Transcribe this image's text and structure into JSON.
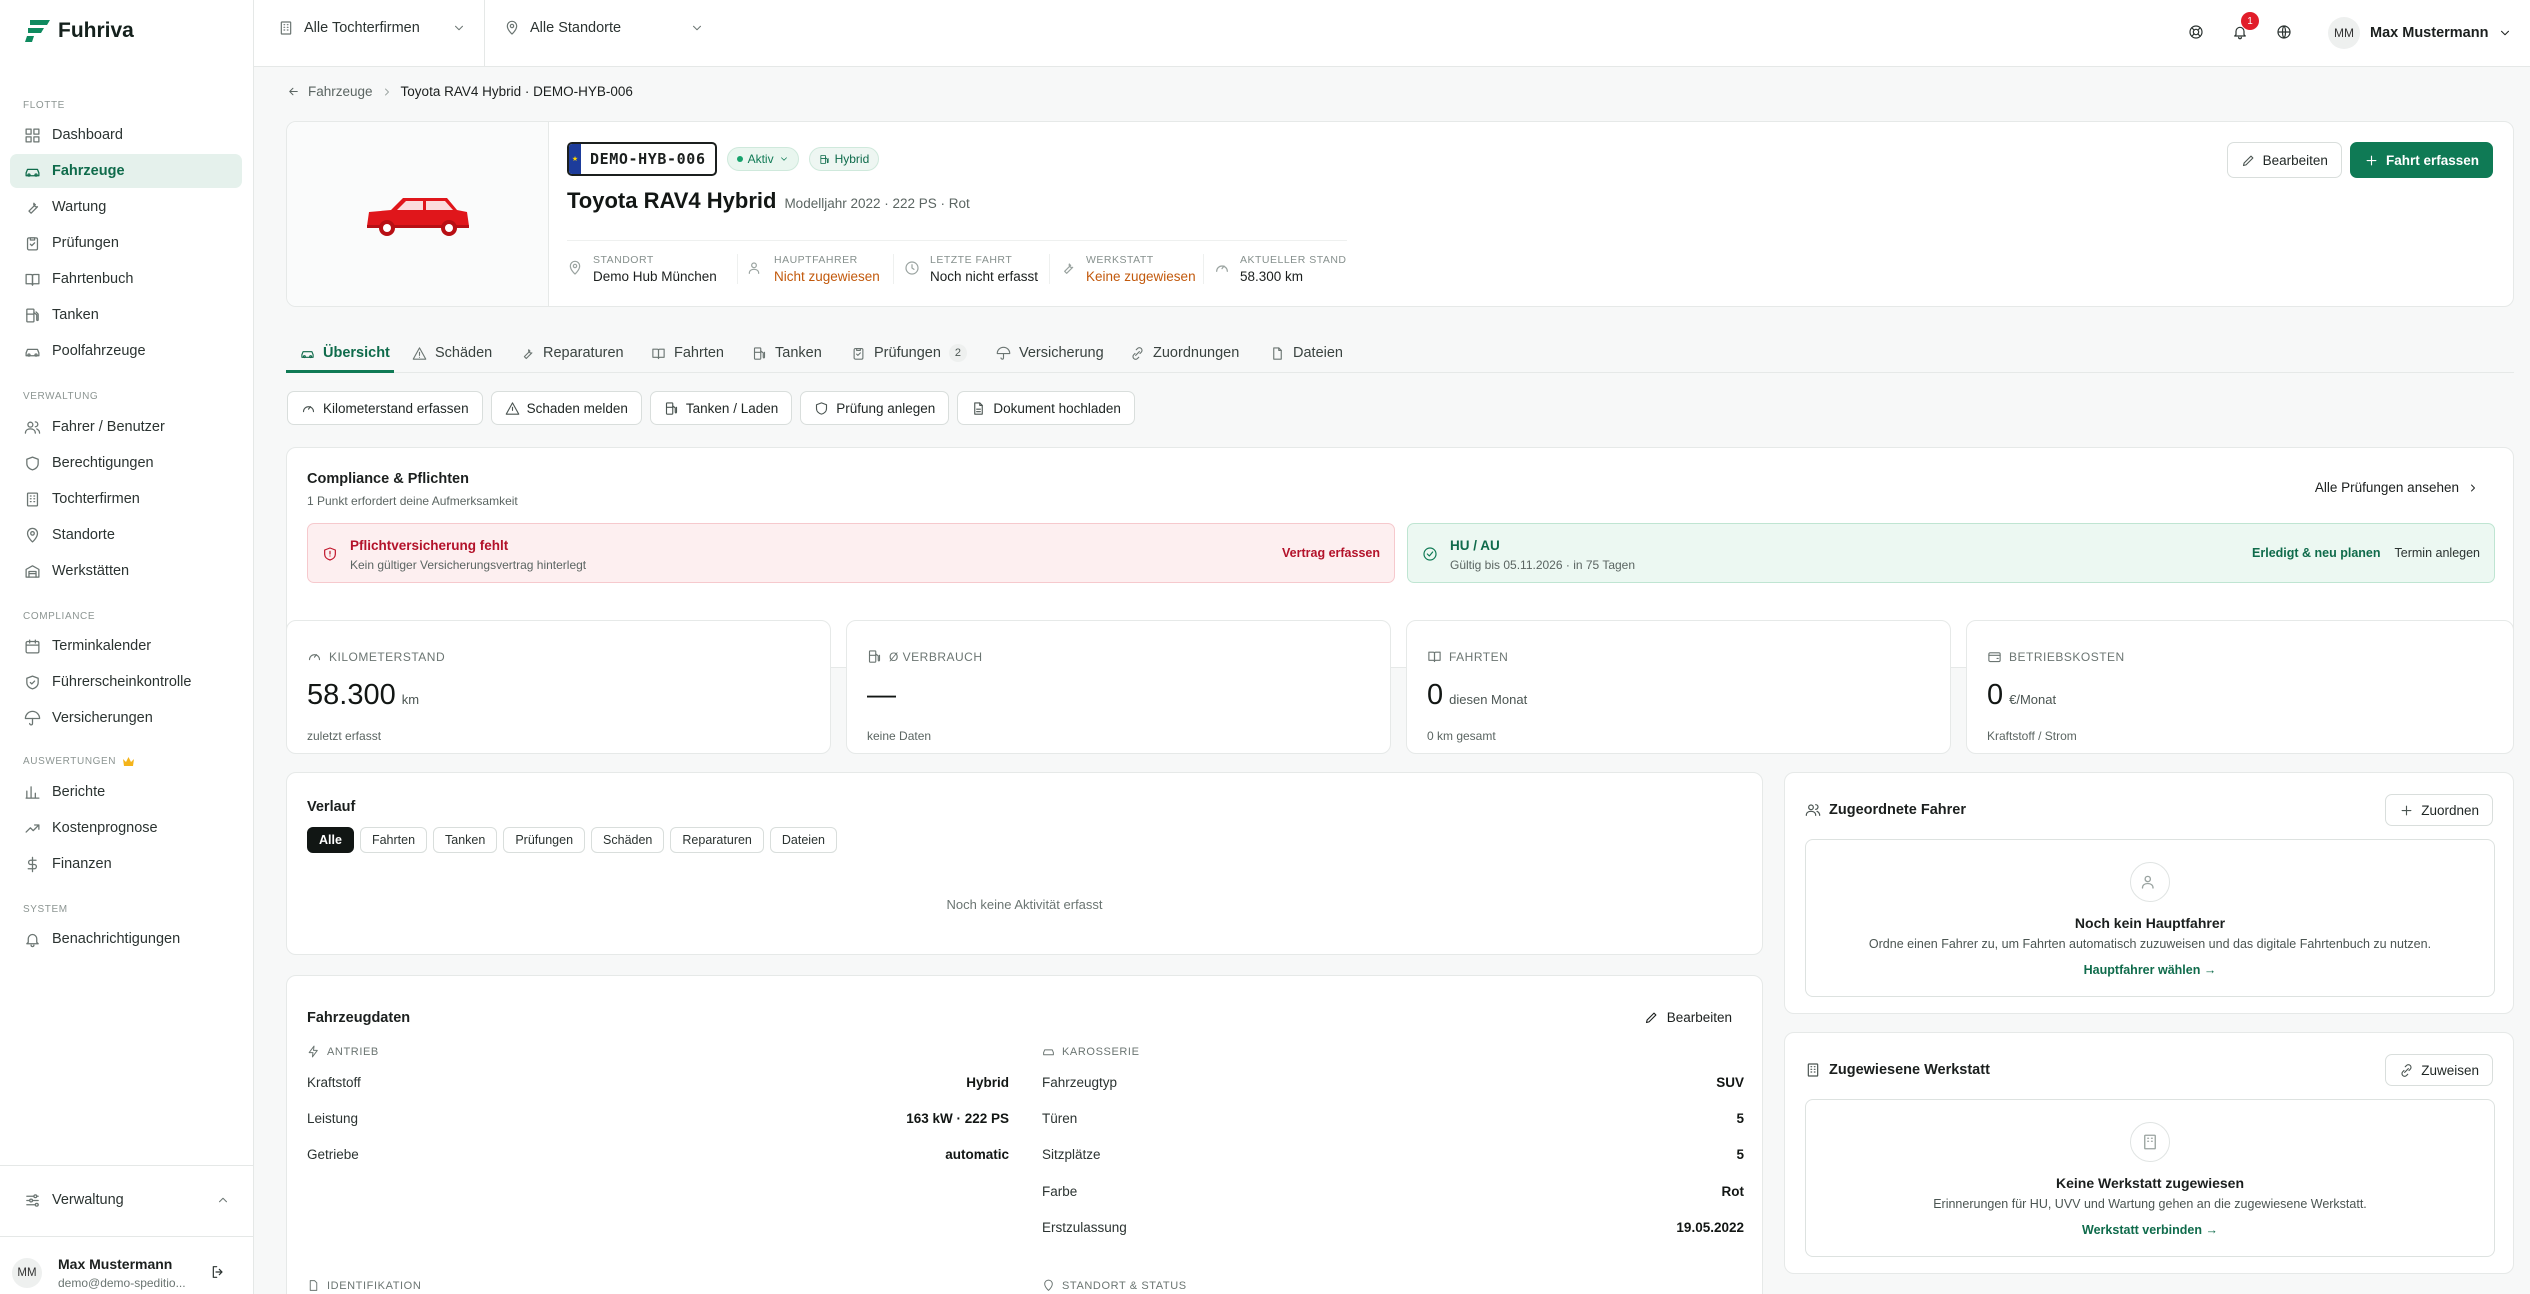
{
  "app": {
    "name": "Fuhriva"
  },
  "sidebar": {
    "sections": [
      {
        "label": "FLOTTE"
      },
      {
        "label": "VERWALTUNG"
      },
      {
        "label": "COMPLIANCE"
      },
      {
        "label": "AUSWERTUNGEN"
      },
      {
        "label": "SYSTEM"
      }
    ],
    "items": [
      {
        "label": "Dashboard",
        "icon": "grid-icon"
      },
      {
        "label": "Fahrzeuge",
        "icon": "car-icon",
        "active": true
      },
      {
        "label": "Wartung",
        "icon": "wrench-icon"
      },
      {
        "label": "Prüfungen",
        "icon": "clipboard-check-icon"
      },
      {
        "label": "Fahrtenbuch",
        "icon": "book-icon"
      },
      {
        "label": "Tanken",
        "icon": "fuel-icon"
      },
      {
        "label": "Poolfahrzeuge",
        "icon": "pool-car-icon"
      },
      {
        "label": "Fahrer / Benutzer",
        "icon": "users-icon"
      },
      {
        "label": "Berechtigungen",
        "icon": "shield-icon"
      },
      {
        "label": "Tochterfirmen",
        "icon": "building-icon"
      },
      {
        "label": "Standorte",
        "icon": "map-pin-icon"
      },
      {
        "label": "Werkstätten",
        "icon": "warehouse-icon"
      },
      {
        "label": "Terminkalender",
        "icon": "calendar-icon"
      },
      {
        "label": "Führerscheinkontrolle",
        "icon": "shield-check-icon"
      },
      {
        "label": "Versicherungen",
        "icon": "umbrella-icon"
      },
      {
        "label": "Berichte",
        "icon": "bar-chart-icon"
      },
      {
        "label": "Kostenprognose",
        "icon": "trending-up-icon"
      },
      {
        "label": "Finanzen",
        "icon": "dollar-icon"
      },
      {
        "label": "Benachrichtigungen",
        "icon": "bell-icon"
      }
    ],
    "footer": {
      "settings_label": "Verwaltung",
      "user_name": "Max Mustermann",
      "user_email": "demo@demo-speditio...",
      "initials": "MM"
    }
  },
  "topbar": {
    "company_select": "Alle Tochterfirmen",
    "location_select": "Alle Standorte",
    "notification_count": "1",
    "user_initials": "MM",
    "user_name": "Max Mustermann"
  },
  "breadcrumb": {
    "parent": "Fahrzeuge",
    "current": "Toyota RAV4 Hybrid · DEMO-HYB-006"
  },
  "vehicle": {
    "plate": "DEMO-HYB-006",
    "status": "Aktiv",
    "fuel_badge": "Hybrid",
    "name": "Toyota RAV4 Hybrid",
    "subtitle": "Modelljahr 2022 · 222 PS · Rot",
    "meta": [
      {
        "label": "STANDORT",
        "value": "Demo Hub München",
        "warn": false
      },
      {
        "label": "HAUPTFAHRER",
        "value": "Nicht zugewiesen",
        "warn": true
      },
      {
        "label": "LETZTE FAHRT",
        "value": "Noch nicht erfasst",
        "warn": false
      },
      {
        "label": "WERKSTATT",
        "value": "Keine zugewiesen",
        "warn": true
      },
      {
        "label": "AKTUELLER STAND",
        "value": "58.300 km",
        "warn": false
      }
    ],
    "edit_label": "Bearbeiten",
    "trip_label": "Fahrt erfassen",
    "car_color": "#e0161b"
  },
  "tabs": [
    {
      "label": "Übersicht",
      "active": true
    },
    {
      "label": "Schäden"
    },
    {
      "label": "Reparaturen"
    },
    {
      "label": "Fahrten"
    },
    {
      "label": "Tanken"
    },
    {
      "label": "Prüfungen",
      "count": "2"
    },
    {
      "label": "Versicherung"
    },
    {
      "label": "Zuordnungen"
    },
    {
      "label": "Dateien"
    }
  ],
  "quick_actions": [
    "Kilometerstand erfassen",
    "Schaden melden",
    "Tanken / Laden",
    "Prüfung anlegen",
    "Dokument hochladen"
  ],
  "compliance": {
    "title": "Compliance & Pflichten",
    "subtitle": "1 Punkt erfordert deine Aufmerksamkeit",
    "link": "Alle Prüfungen ansehen",
    "alert": {
      "title": "Pflichtversicherung fehlt",
      "desc": "Kein gültiger Versicherungsvertrag hinterlegt",
      "action": "Vertrag erfassen"
    },
    "ok": {
      "title": "HU / AU",
      "desc": "Gültig bis 05.11.2026 · in 75 Tagen",
      "action1": "Erledigt & neu planen",
      "action2": "Termin anlegen"
    }
  },
  "stats": [
    {
      "label": "KILOMETERSTAND",
      "value": "58.300",
      "unit": "km",
      "sub": "zuletzt erfasst"
    },
    {
      "label": "Ø VERBRAUCH",
      "value": "—",
      "unit": "",
      "sub": "keine Daten"
    },
    {
      "label": "FAHRTEN",
      "value": "0",
      "unit": "diesen Monat",
      "sub": "0 km gesamt"
    },
    {
      "label": "BETRIEBSKOSTEN",
      "value": "0",
      "unit": "€/Monat",
      "sub": "Kraftstoff / Strom"
    }
  ],
  "history": {
    "title": "Verlauf",
    "filters": [
      "Alle",
      "Fahrten",
      "Tanken",
      "Prüfungen",
      "Schäden",
      "Reparaturen",
      "Dateien"
    ],
    "empty": "Noch keine Aktivität erfasst"
  },
  "vehicle_data": {
    "title": "Fahrzeugdaten",
    "edit": "Bearbeiten",
    "drive": {
      "title": "ANTRIEB",
      "rows": [
        [
          "Kraftstoff",
          "Hybrid"
        ],
        [
          "Leistung",
          "163 kW · 222 PS"
        ],
        [
          "Getriebe",
          "automatic"
        ]
      ]
    },
    "body": {
      "title": "KAROSSERIE",
      "rows": [
        [
          "Fahrzeugtyp",
          "SUV"
        ],
        [
          "Türen",
          "5"
        ],
        [
          "Sitzplätze",
          "5"
        ],
        [
          "Farbe",
          "Rot"
        ],
        [
          "Erstzulassung",
          "19.05.2022"
        ]
      ]
    },
    "ident_title": "IDENTIFIKATION",
    "location_title": "STANDORT & STATUS"
  },
  "drivers": {
    "title": "Zugeordnete Fahrer",
    "button": "Zuordnen",
    "empty_title": "Noch kein Hauptfahrer",
    "empty_desc": "Ordne einen Fahrer zu, um Fahrten automatisch zuzuweisen und das digitale Fahrtenbuch zu nutzen.",
    "empty_link": "Hauptfahrer wählen →"
  },
  "workshop": {
    "title": "Zugewiesene Werkstatt",
    "button": "Zuweisen",
    "empty_title": "Keine Werkstatt zugewiesen",
    "empty_desc": "Erinnerungen für HU, UVV und Wartung gehen an die zugewiesene Werkstatt.",
    "empty_link": "Werkstatt verbinden →"
  }
}
